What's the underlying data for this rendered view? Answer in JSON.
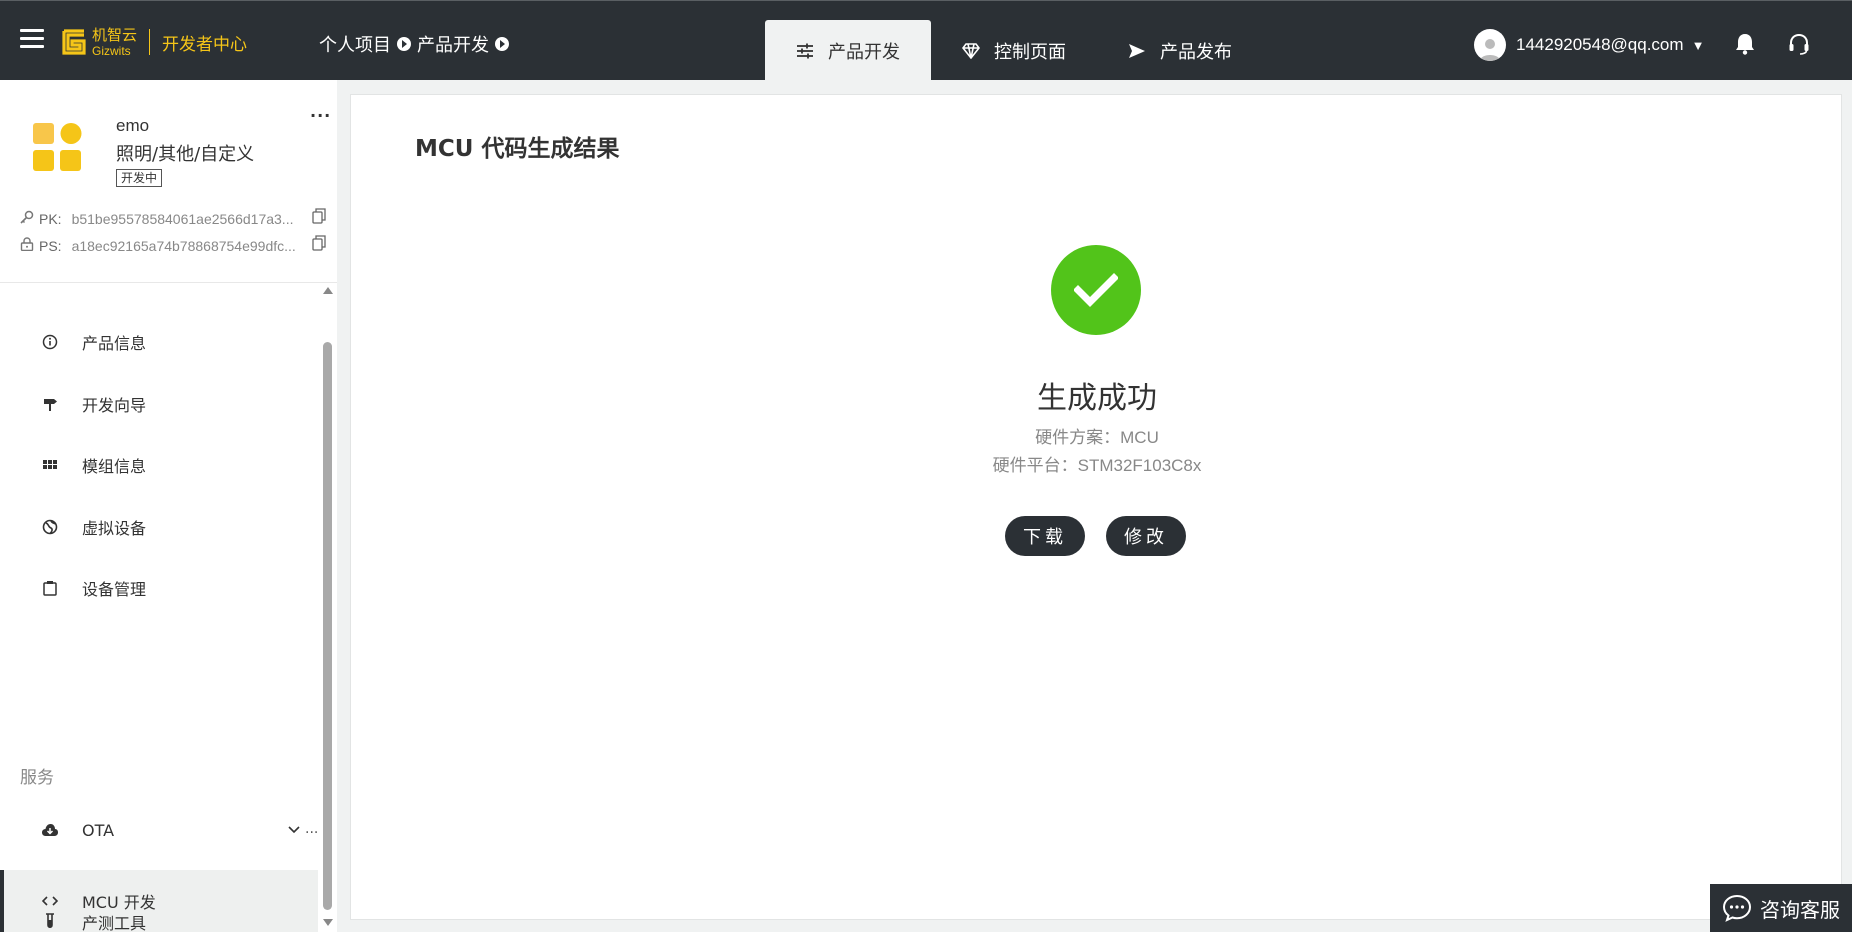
{
  "header": {
    "logo_cn": "机智云",
    "logo_en": "Gizwits",
    "logo_sub": "开发者中心",
    "breadcrumb": [
      "个人项目",
      "产品开发"
    ],
    "tabs": [
      {
        "label": "产品开发",
        "icon": "sliders-icon",
        "active": true
      },
      {
        "label": "控制页面",
        "icon": "diamond-icon",
        "active": false
      },
      {
        "label": "产品发布",
        "icon": "send-icon",
        "active": false
      }
    ],
    "user_email": "1442920548@qq.com",
    "user_caret": "▼"
  },
  "product": {
    "name": "emo",
    "category": "照明/其他/自定义",
    "status": "开发中",
    "more": "···",
    "pk_label": "PK:",
    "pk_value": "b51be95578584061ae2566d17a3...",
    "ps_label": "PS:",
    "ps_value": "a18ec92165a74b78868754e99dfc..."
  },
  "menu": {
    "items": [
      {
        "label": "产品信息",
        "icon": "info-icon"
      },
      {
        "label": "开发向导",
        "icon": "signpost-icon"
      },
      {
        "label": "模组信息",
        "icon": "grid-icon"
      },
      {
        "label": "虚拟设备",
        "icon": "globe-icon"
      },
      {
        "label": "设备管理",
        "icon": "clipboard-icon"
      }
    ],
    "group_service": "服务",
    "service_items": [
      {
        "label": "OTA",
        "icon": "cloud-download-icon"
      },
      {
        "label": "MCU 开发",
        "icon": "code-icon",
        "active": true
      },
      {
        "label": "产测工具",
        "icon": "test-tube-icon"
      }
    ],
    "ota_more": "..."
  },
  "main": {
    "title": "MCU 代码生成结果",
    "result_title": "生成成功",
    "hardware_scheme": "硬件方案：MCU",
    "hardware_platform": "硬件平台：STM32F103C8x",
    "download_label": "下载",
    "modify_label": "修改"
  },
  "consult": {
    "label": "咨询客服"
  },
  "colors": {
    "topbar": "#2b3035",
    "brand_yellow": "#f5c518",
    "success_green": "#52c41a"
  }
}
